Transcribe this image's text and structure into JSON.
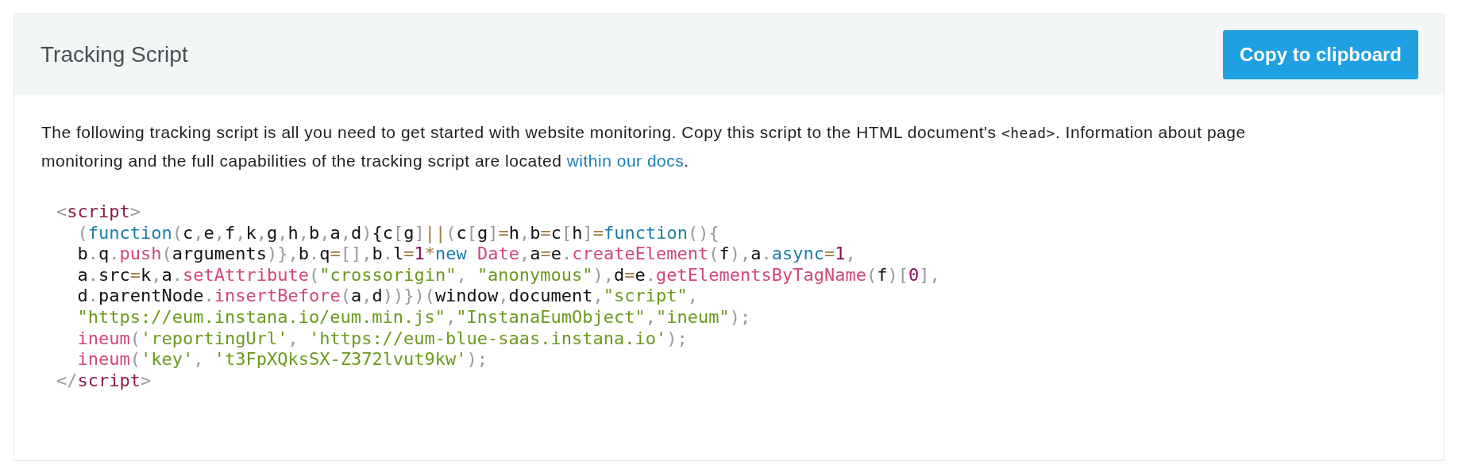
{
  "panel": {
    "title": "Tracking Script",
    "copy_button": "Copy to clipboard"
  },
  "intro": {
    "text_before": "The following tracking script is all you need to get started with website monitoring. Copy this script to the HTML document's ",
    "code": "<head>",
    "text_after": ". Information about page monitoring and the full capabilities of the tracking script are located ",
    "link": "within our docs",
    "text_end": "."
  },
  "code_lines": [
    {
      "indented": false,
      "tokens": [
        {
          "kind": "punct",
          "text": "<"
        },
        {
          "kind": "tag",
          "text": "script"
        },
        {
          "kind": "punct",
          "text": ">"
        }
      ]
    },
    {
      "indented": true,
      "tokens": [
        {
          "kind": "punct",
          "text": "("
        },
        {
          "kind": "keyword",
          "text": "function"
        },
        {
          "kind": "punct",
          "text": "("
        },
        {
          "kind": "text",
          "text": "c"
        },
        {
          "kind": "punct",
          "text": ","
        },
        {
          "kind": "text",
          "text": "e"
        },
        {
          "kind": "punct",
          "text": ","
        },
        {
          "kind": "text",
          "text": "f"
        },
        {
          "kind": "punct",
          "text": ","
        },
        {
          "kind": "text",
          "text": "k"
        },
        {
          "kind": "punct",
          "text": ","
        },
        {
          "kind": "text",
          "text": "g"
        },
        {
          "kind": "punct",
          "text": ","
        },
        {
          "kind": "text",
          "text": "h"
        },
        {
          "kind": "punct",
          "text": ","
        },
        {
          "kind": "text",
          "text": "b"
        },
        {
          "kind": "punct",
          "text": ","
        },
        {
          "kind": "text",
          "text": "a"
        },
        {
          "kind": "punct",
          "text": ","
        },
        {
          "kind": "text",
          "text": "d"
        },
        {
          "kind": "punct",
          "text": ")"
        },
        {
          "kind": "text",
          "text": "{c"
        },
        {
          "kind": "punct",
          "text": "["
        },
        {
          "kind": "text",
          "text": "g"
        },
        {
          "kind": "punct",
          "text": "]"
        },
        {
          "kind": "operator",
          "text": "||"
        },
        {
          "kind": "punct",
          "text": "("
        },
        {
          "kind": "text",
          "text": "c"
        },
        {
          "kind": "punct",
          "text": "["
        },
        {
          "kind": "text",
          "text": "g"
        },
        {
          "kind": "punct",
          "text": "]"
        },
        {
          "kind": "operator",
          "text": "="
        },
        {
          "kind": "text",
          "text": "h"
        },
        {
          "kind": "punct",
          "text": ","
        },
        {
          "kind": "text",
          "text": "b"
        },
        {
          "kind": "operator",
          "text": "="
        },
        {
          "kind": "text",
          "text": "c"
        },
        {
          "kind": "punct",
          "text": "["
        },
        {
          "kind": "text",
          "text": "h"
        },
        {
          "kind": "punct",
          "text": "]"
        },
        {
          "kind": "operator",
          "text": "="
        },
        {
          "kind": "keyword",
          "text": "function"
        },
        {
          "kind": "punct",
          "text": "(){"
        }
      ]
    },
    {
      "indented": true,
      "tokens": [
        {
          "kind": "text",
          "text": "b"
        },
        {
          "kind": "punct",
          "text": "."
        },
        {
          "kind": "text",
          "text": "q"
        },
        {
          "kind": "punct",
          "text": "."
        },
        {
          "kind": "method",
          "text": "push"
        },
        {
          "kind": "punct",
          "text": "("
        },
        {
          "kind": "text",
          "text": "arguments"
        },
        {
          "kind": "punct",
          "text": ")},"
        },
        {
          "kind": "text",
          "text": "b"
        },
        {
          "kind": "punct",
          "text": "."
        },
        {
          "kind": "text",
          "text": "q"
        },
        {
          "kind": "operator",
          "text": "="
        },
        {
          "kind": "punct",
          "text": "[],"
        },
        {
          "kind": "text",
          "text": "b"
        },
        {
          "kind": "punct",
          "text": "."
        },
        {
          "kind": "text",
          "text": "l"
        },
        {
          "kind": "operator",
          "text": "="
        },
        {
          "kind": "number",
          "text": "1"
        },
        {
          "kind": "operator",
          "text": "*"
        },
        {
          "kind": "keyword",
          "text": "new "
        },
        {
          "kind": "method",
          "text": "Date"
        },
        {
          "kind": "punct",
          "text": ","
        },
        {
          "kind": "text",
          "text": "a"
        },
        {
          "kind": "operator",
          "text": "="
        },
        {
          "kind": "text",
          "text": "e"
        },
        {
          "kind": "punct",
          "text": "."
        },
        {
          "kind": "method",
          "text": "createElement"
        },
        {
          "kind": "punct",
          "text": "("
        },
        {
          "kind": "text",
          "text": "f"
        },
        {
          "kind": "punct",
          "text": "),"
        },
        {
          "kind": "text",
          "text": "a"
        },
        {
          "kind": "punct",
          "text": "."
        },
        {
          "kind": "keyword",
          "text": "async"
        },
        {
          "kind": "operator",
          "text": "="
        },
        {
          "kind": "number",
          "text": "1"
        },
        {
          "kind": "punct",
          "text": ","
        }
      ]
    },
    {
      "indented": true,
      "tokens": [
        {
          "kind": "text",
          "text": "a"
        },
        {
          "kind": "punct",
          "text": "."
        },
        {
          "kind": "text",
          "text": "src"
        },
        {
          "kind": "operator",
          "text": "="
        },
        {
          "kind": "text",
          "text": "k"
        },
        {
          "kind": "punct",
          "text": ","
        },
        {
          "kind": "text",
          "text": "a"
        },
        {
          "kind": "punct",
          "text": "."
        },
        {
          "kind": "method",
          "text": "setAttribute"
        },
        {
          "kind": "punct",
          "text": "("
        },
        {
          "kind": "string",
          "text": "\"crossorigin\""
        },
        {
          "kind": "punct",
          "text": ", "
        },
        {
          "kind": "string",
          "text": "\"anonymous\""
        },
        {
          "kind": "punct",
          "text": "),"
        },
        {
          "kind": "text",
          "text": "d"
        },
        {
          "kind": "operator",
          "text": "="
        },
        {
          "kind": "text",
          "text": "e"
        },
        {
          "kind": "punct",
          "text": "."
        },
        {
          "kind": "method",
          "text": "getElementsByTagName"
        },
        {
          "kind": "punct",
          "text": "("
        },
        {
          "kind": "text",
          "text": "f"
        },
        {
          "kind": "punct",
          "text": ")["
        },
        {
          "kind": "number",
          "text": "0"
        },
        {
          "kind": "punct",
          "text": "],"
        }
      ]
    },
    {
      "indented": true,
      "tokens": [
        {
          "kind": "text",
          "text": "d"
        },
        {
          "kind": "punct",
          "text": "."
        },
        {
          "kind": "text",
          "text": "parentNode"
        },
        {
          "kind": "punct",
          "text": "."
        },
        {
          "kind": "method",
          "text": "insertBefore"
        },
        {
          "kind": "punct",
          "text": "("
        },
        {
          "kind": "text",
          "text": "a"
        },
        {
          "kind": "punct",
          "text": ","
        },
        {
          "kind": "text",
          "text": "d"
        },
        {
          "kind": "punct",
          "text": "))})("
        },
        {
          "kind": "text",
          "text": "window"
        },
        {
          "kind": "punct",
          "text": ","
        },
        {
          "kind": "text",
          "text": "document"
        },
        {
          "kind": "punct",
          "text": ","
        },
        {
          "kind": "string",
          "text": "\"script\""
        },
        {
          "kind": "punct",
          "text": ","
        }
      ]
    },
    {
      "indented": true,
      "tokens": [
        {
          "kind": "string",
          "text": "\"https://eum.instana.io/eum.min.js\""
        },
        {
          "kind": "punct",
          "text": ","
        },
        {
          "kind": "string",
          "text": "\"InstanaEumObject\""
        },
        {
          "kind": "punct",
          "text": ","
        },
        {
          "kind": "string",
          "text": "\"ineum\""
        },
        {
          "kind": "punct",
          "text": ");"
        }
      ]
    },
    {
      "indented": true,
      "tokens": [
        {
          "kind": "method",
          "text": "ineum"
        },
        {
          "kind": "punct",
          "text": "("
        },
        {
          "kind": "string",
          "text": "'reportingUrl'"
        },
        {
          "kind": "punct",
          "text": ", "
        },
        {
          "kind": "string",
          "text": "'https://eum-blue-saas.instana.io'"
        },
        {
          "kind": "punct",
          "text": ");"
        }
      ]
    },
    {
      "indented": true,
      "tokens": [
        {
          "kind": "method",
          "text": "ineum"
        },
        {
          "kind": "punct",
          "text": "("
        },
        {
          "kind": "string",
          "text": "'key'"
        },
        {
          "kind": "punct",
          "text": ", "
        },
        {
          "kind": "string",
          "text": "'t3FpXQksSX-Z372lvut9kw'"
        },
        {
          "kind": "punct",
          "text": ");"
        }
      ]
    },
    {
      "indented": false,
      "tokens": [
        {
          "kind": "punct",
          "text": "</"
        },
        {
          "kind": "tag",
          "text": "script"
        },
        {
          "kind": "punct",
          "text": ">"
        }
      ]
    }
  ]
}
